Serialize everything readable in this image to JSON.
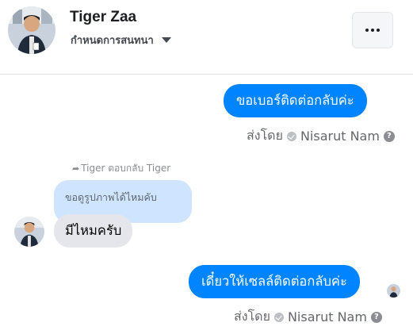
{
  "header": {
    "title": "Tiger Zaa",
    "subtitle": "กำหนดการสนทนา",
    "more_label": "More options"
  },
  "messages": [
    {
      "direction": "out",
      "text": "ขอเบอร์ติดต่อกลับค่ะ",
      "sent_by_prefix": "ส่งโดย",
      "sent_by_name": "Nisarut Nam"
    },
    {
      "direction": "in",
      "reply_note": "Tiger ตอบกลับ Tiger",
      "quoted_text": "ขอดูรูปภาพได้ไหมคับ",
      "text": "มีไหมครับ"
    },
    {
      "direction": "out",
      "text": "เดี๋ยวให้เซลล์ติดต่อกลับค่ะ",
      "sent_by_prefix": "ส่งโดย",
      "sent_by_name": "Nisarut Nam"
    }
  ],
  "colors": {
    "outgoing_bubble": "#0084ff",
    "incoming_bubble": "#e4e6eb",
    "quoted_bubble": "#cfe4ff"
  }
}
